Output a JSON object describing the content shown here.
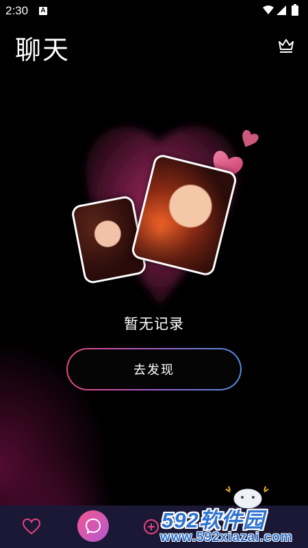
{
  "status_bar": {
    "time": "2:30",
    "notification_icon": "a-icon",
    "icons": [
      "wifi-icon",
      "signal-icon",
      "battery-icon"
    ]
  },
  "header": {
    "title": "聊天",
    "vip_icon": "crown-icon"
  },
  "empty_state": {
    "message": "暂无记录",
    "action_label": "去发现"
  },
  "bottom_nav": {
    "items": [
      {
        "icon": "heart-icon"
      },
      {
        "icon": "chat-icon",
        "active": true
      },
      {
        "icon": "add-icon"
      }
    ],
    "accent_colors": [
      "#f0568f",
      "#b659d3"
    ]
  },
  "watermark": {
    "brand": "592软件园",
    "url": "www.592xiazai.com"
  },
  "colors": {
    "background": "#000000",
    "nav_background": "#1a1834",
    "button_border_start": "#e8457f",
    "button_border_end": "#4f8fe0"
  }
}
